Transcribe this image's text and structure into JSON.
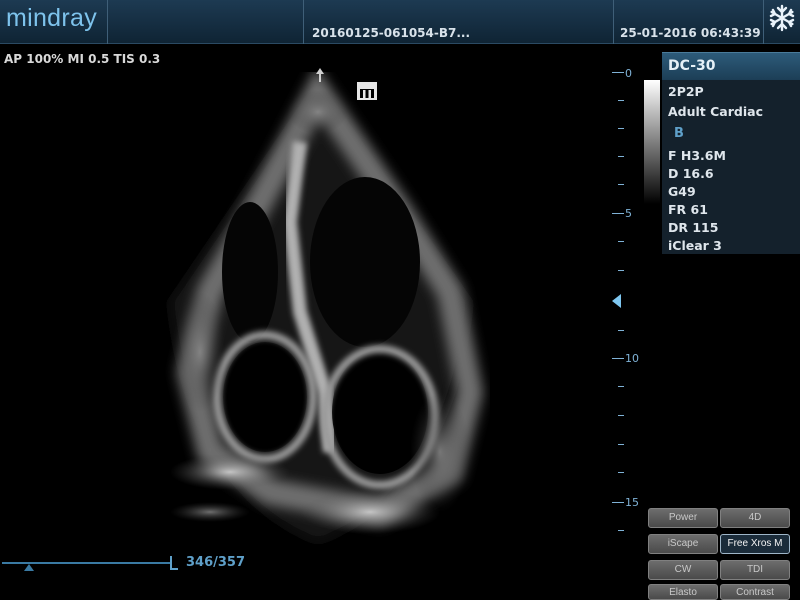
{
  "header": {
    "logo": "mindray",
    "study_id": "20160125-061054-B7...",
    "datetime": "25-01-2016 06:43:39",
    "freeze_icon": "snowflake-icon"
  },
  "acoustic_output": "AP 100%  MI 0.5 TIS 0.3",
  "probe_orientation_mark": "m",
  "params": {
    "probe": "DC-30",
    "transducer": "2P2P",
    "exam": "Adult Cardiac",
    "mode": "B",
    "rows": [
      "F H3.6M",
      "D 16.6",
      "G49",
      "FR 61",
      "DR 115",
      "iClear 3"
    ]
  },
  "depth_scale": {
    "labels": [
      "0",
      "5",
      "10",
      "15"
    ]
  },
  "cine": {
    "frame_counter": "346/357"
  },
  "soft_buttons": [
    {
      "label": "Power",
      "active": false
    },
    {
      "label": "4D",
      "active": false
    },
    {
      "label": "iScape",
      "active": false
    },
    {
      "label": "Free Xros M",
      "active": true
    },
    {
      "label": "CW",
      "active": false
    },
    {
      "label": "TDI",
      "active": false
    },
    {
      "label": "Elasto",
      "active": false
    },
    {
      "label": "Contrast",
      "active": false
    }
  ]
}
